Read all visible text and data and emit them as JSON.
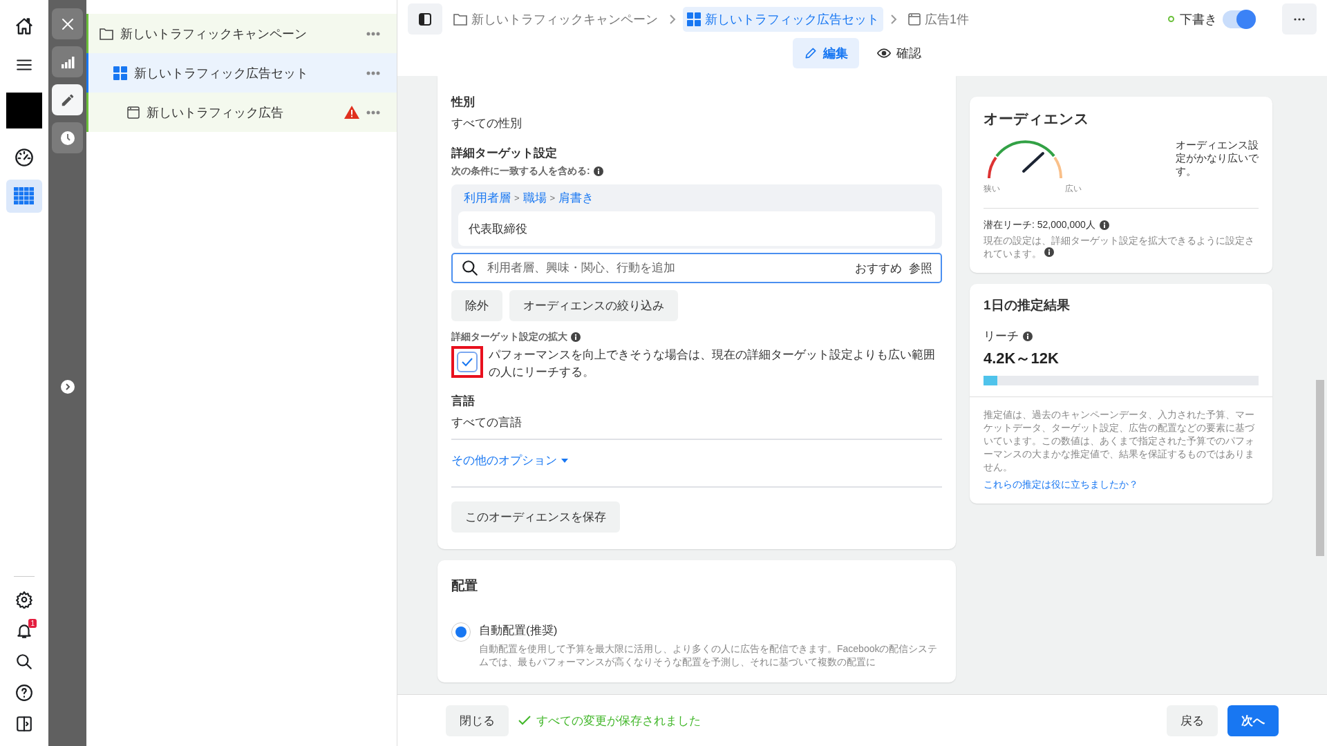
{
  "nav": {
    "top": [
      {
        "kind": "home",
        "selected": false
      },
      {
        "kind": "menu",
        "selected": false
      },
      {
        "kind": "account"
      },
      {
        "kind": "gauge",
        "selected": false
      },
      {
        "kind": "table",
        "selected": true
      }
    ],
    "bottom": [
      {
        "kind": "settings"
      },
      {
        "kind": "bell",
        "badge": "1"
      },
      {
        "kind": "search"
      },
      {
        "kind": "help"
      },
      {
        "kind": "panel"
      }
    ]
  },
  "rail": [
    {
      "kind": "close",
      "selected": false
    },
    {
      "kind": "chart",
      "selected": false
    },
    {
      "kind": "edit",
      "selected": true
    },
    {
      "kind": "clock",
      "selected": false
    }
  ],
  "tree": [
    {
      "label": "新しいトラフィックキャンペーン",
      "kind": "folder",
      "selected": false,
      "warning": false,
      "children": [
        {
          "label": "新しいトラフィック広告セット",
          "kind": "grid",
          "selected": true,
          "warning": false,
          "children": [
            {
              "label": "新しいトラフィック広告",
              "kind": "page",
              "selected": false,
              "warning": true
            }
          ]
        }
      ]
    }
  ],
  "header": {
    "breadcrumb": [
      {
        "label": "新しいトラフィックキャンペーン",
        "kind": "folder",
        "selected": false
      },
      {
        "label": "新しいトラフィック広告セット",
        "kind": "grid",
        "selected": true
      },
      {
        "label": "広告1件",
        "kind": "page",
        "selected": false
      }
    ],
    "status": {
      "label": "下書き",
      "on": true
    },
    "tabs": [
      {
        "label": "編集",
        "kind": "edit",
        "selected": true
      },
      {
        "label": "確認",
        "kind": "view",
        "selected": false
      }
    ]
  },
  "audience_form": {
    "gender": {
      "label": "性別",
      "value": "すべての性別"
    },
    "detailed": {
      "label": "詳細ターゲット設定",
      "sublabel": "次の条件に一致する人を含める:",
      "path": [
        {
          "label": "利用者層"
        },
        {
          "sep": ">",
          "label": "職場"
        },
        {
          "sep": ">",
          "label": "肩書き"
        }
      ],
      "selected_item": "代表取締役",
      "search": {
        "placeholder": "利用者層、興味・関心、行動を追加",
        "links": [
          "おすすめ",
          "参照"
        ]
      },
      "buttons": [
        "除外",
        "オーディエンスの絞り込み"
      ]
    },
    "expansion": {
      "label": "詳細ターゲット設定の拡大",
      "checked": true,
      "text": "パフォーマンスを向上できそうな場合は、現在の詳細ターゲット設定よりも広い範囲の人にリーチする。"
    },
    "language": {
      "label": "言語",
      "value": "すべての言語"
    },
    "more_options": "その他のオプション",
    "save_button": "このオーディエンスを保存"
  },
  "placement": {
    "title": "配置",
    "options": [
      {
        "label": "自動配置(推奨)",
        "selected": true,
        "description": "自動配置を使用して予算を最大限に活用し、より多くの人に広告を配信できます。Facebookの配信システムでは、最もパフォーマンスが高くなりそうな配置を予測し、それに基づいて複数の配置に"
      }
    ]
  },
  "audience_card": {
    "title": "オーディエンス",
    "gauge_min": "狭い",
    "gauge_max": "広い",
    "summary": "オーディエンス設定がかなり広いです。",
    "reach": "潜在リーチ: 52,000,000人",
    "note": "現在の設定は、詳細ターゲット設定を拡大できるように設定されています。"
  },
  "estimate_card": {
    "title": "1日の推定結果",
    "metric": "リーチ",
    "value": "4.2K～12K",
    "level": 0.05,
    "note": "推定値は、過去のキャンペーンデータ、入力された予算、マーケットデータ、ターゲット設定、広告の配置などの要素に基づいています。この数値は、あくまで指定された予算でのパフォーマンスの大まかな推定値で、結果を保証するものではありません。",
    "link": "これらの推定は役に立ちましたか？"
  },
  "footer": {
    "close": "閉じる",
    "saved": "すべての変更が保存されました",
    "back": "戻る",
    "next": "次へ"
  }
}
